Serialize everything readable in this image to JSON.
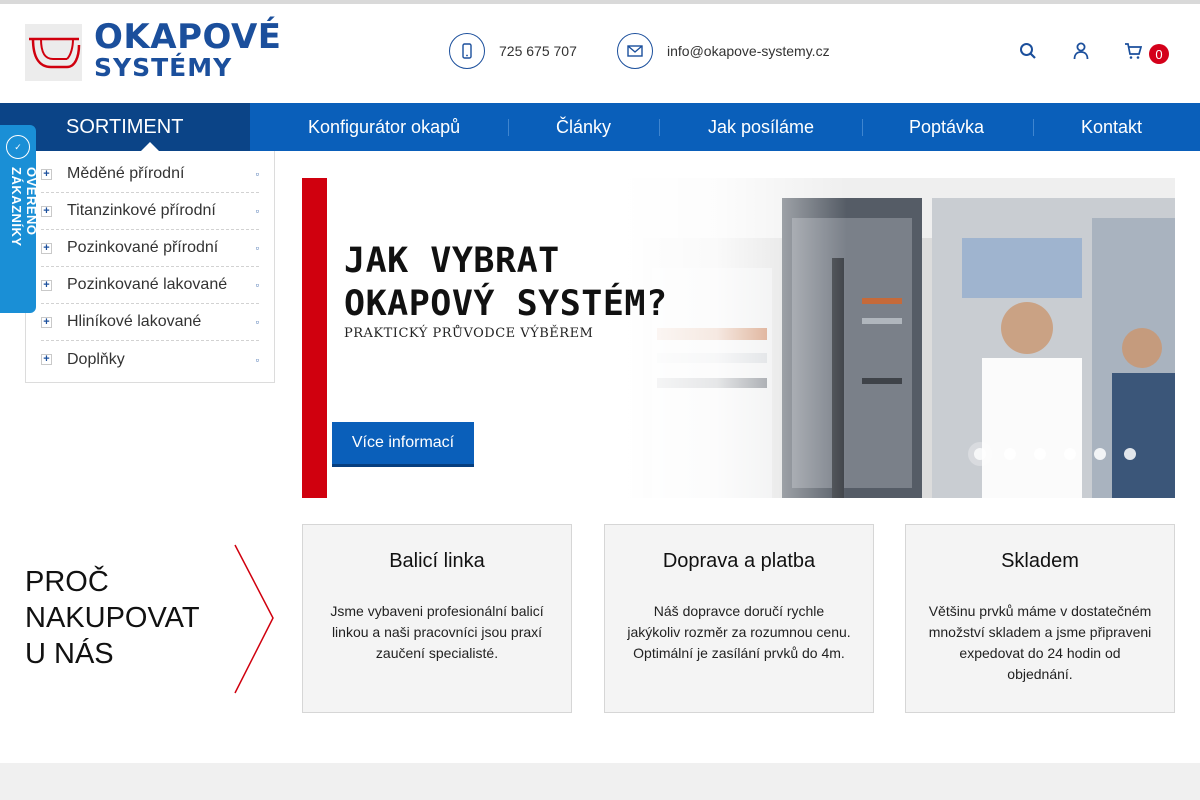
{
  "brand": {
    "line1": "OKAPOVÉ",
    "line2": "SYSTÉMY",
    "color": "#1b4f9c",
    "accent": "#d0000e"
  },
  "header": {
    "phone": "725 675 707",
    "email": "info@okapove-systemy.cz",
    "phone_icon": "phone-icon",
    "email_icon": "email-icon",
    "cart_count": "0"
  },
  "nav": {
    "sortiment": "SORTIMENT",
    "items": [
      "Konfigurátor okapů",
      "Články",
      "Jak posíláme",
      "Poptávka",
      "Kontakt"
    ]
  },
  "sidebar": {
    "items": [
      {
        "label": "Měděné přírodní"
      },
      {
        "label": "Titanzinkové přírodní"
      },
      {
        "label": "Pozinkované přírodní"
      },
      {
        "label": "Pozinkované lakované"
      },
      {
        "label": "Hliníkové lakované"
      },
      {
        "label": "Doplňky"
      }
    ]
  },
  "verified": {
    "label": "OVĚŘENO ZÁKAZNÍKY"
  },
  "hero": {
    "title1": "JAK VYBRAT",
    "title2": "OKAPOVÝ SYSTÉM?",
    "subtitle": "PRAKTICKÝ PRŮVODCE VÝBĚREM",
    "button": "Více informací",
    "slides": 6,
    "active_slide": 1
  },
  "why": {
    "line1": "PROČ",
    "line2": "NAKUPOVAT",
    "line3": "U NÁS"
  },
  "cards": [
    {
      "title": "Balicí linka",
      "text": "Jsme vybaveni profesionální balicí linkou a naši pracovníci jsou praxí zaučení specialisté."
    },
    {
      "title": "Doprava a platba",
      "text": "Náš dopravce doručí rychle jakýkoliv rozměr za rozumnou cenu. Optimální je zasílání prvků do 4m."
    },
    {
      "title": "Skladem",
      "text": "Většinu prvků máme v dostatečném množství skladem a jsme připraveni expedovat do 24 hodin od objednání."
    }
  ]
}
